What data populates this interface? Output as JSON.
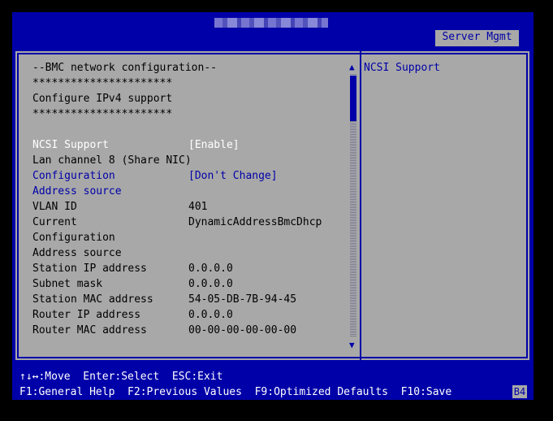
{
  "header": {
    "tab_label": "Server Mgmt"
  },
  "left_panel": {
    "lines": [
      {
        "label": "--BMC network configuration--",
        "value": ""
      },
      {
        "label": "**********************",
        "value": ""
      },
      {
        "label": "Configure IPv4 support",
        "value": ""
      },
      {
        "label": "**********************",
        "value": ""
      },
      {
        "label": "NCSI Support",
        "value": "[Enable]"
      },
      {
        "label": "Lan channel 8 (Share NIC)",
        "value": ""
      },
      {
        "label": "Configuration",
        "value": "[Don't Change]"
      },
      {
        "label": "Address source",
        "value": ""
      },
      {
        "label": "VLAN ID",
        "value": "401"
      },
      {
        "label": "Current",
        "value": "DynamicAddressBmcDhcp"
      },
      {
        "label": "Configuration",
        "value": ""
      },
      {
        "label": "Address source",
        "value": ""
      },
      {
        "label": "Station IP address",
        "value": "0.0.0.0"
      },
      {
        "label": "Subnet mask",
        "value": "0.0.0.0"
      },
      {
        "label": "Station MAC address",
        "value": "54-05-DB-7B-94-45"
      },
      {
        "label": "Router IP address",
        "value": "0.0.0.0"
      },
      {
        "label": "Router MAC address",
        "value": "00-00-00-00-00-00"
      }
    ]
  },
  "help_panel": {
    "text": "NCSI Support"
  },
  "scrollbar": {
    "up_arrow": "▲",
    "down_arrow": "▼"
  },
  "footer": {
    "line1": "↑↓↔:Move  Enter:Select  ESC:Exit",
    "line2": "F1:General Help  F2:Previous Values  F9:Optimized Defaults  F10:Save"
  },
  "badge": "B4"
}
